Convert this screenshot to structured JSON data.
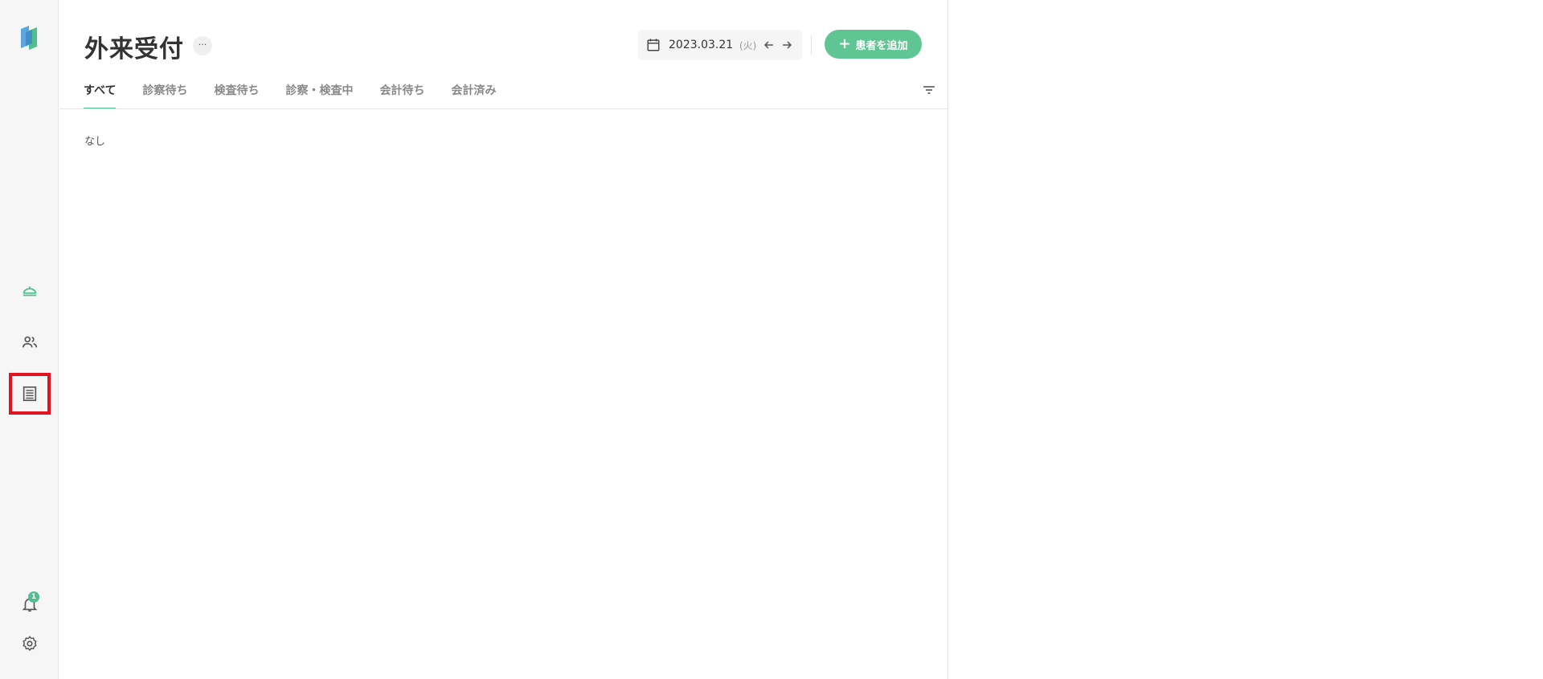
{
  "sidebar": {
    "notifications_badge": "1",
    "items": [
      {
        "name": "reception",
        "icon": "reception-bell-icon"
      },
      {
        "name": "patients",
        "icon": "people-icon"
      },
      {
        "name": "records",
        "icon": "records-list-icon"
      },
      {
        "name": "notifications",
        "icon": "bell-icon"
      },
      {
        "name": "settings",
        "icon": "gear-icon"
      }
    ]
  },
  "header": {
    "title": "外来受付",
    "more_label": "···",
    "date": "2023.03.21",
    "weekday": "(火)",
    "add_button_label": "患者を追加",
    "add_button_icon": "+"
  },
  "tabs": [
    {
      "label": "すべて",
      "active": true
    },
    {
      "label": "診察待ち"
    },
    {
      "label": "検査待ち"
    },
    {
      "label": "診察・検査中"
    },
    {
      "label": "会計待ち"
    },
    {
      "label": "会計済み"
    }
  ],
  "content": {
    "empty_text": "なし"
  },
  "colors": {
    "accent": "#4fc08d",
    "button": "#5ec593",
    "highlight": "#e1131f"
  }
}
